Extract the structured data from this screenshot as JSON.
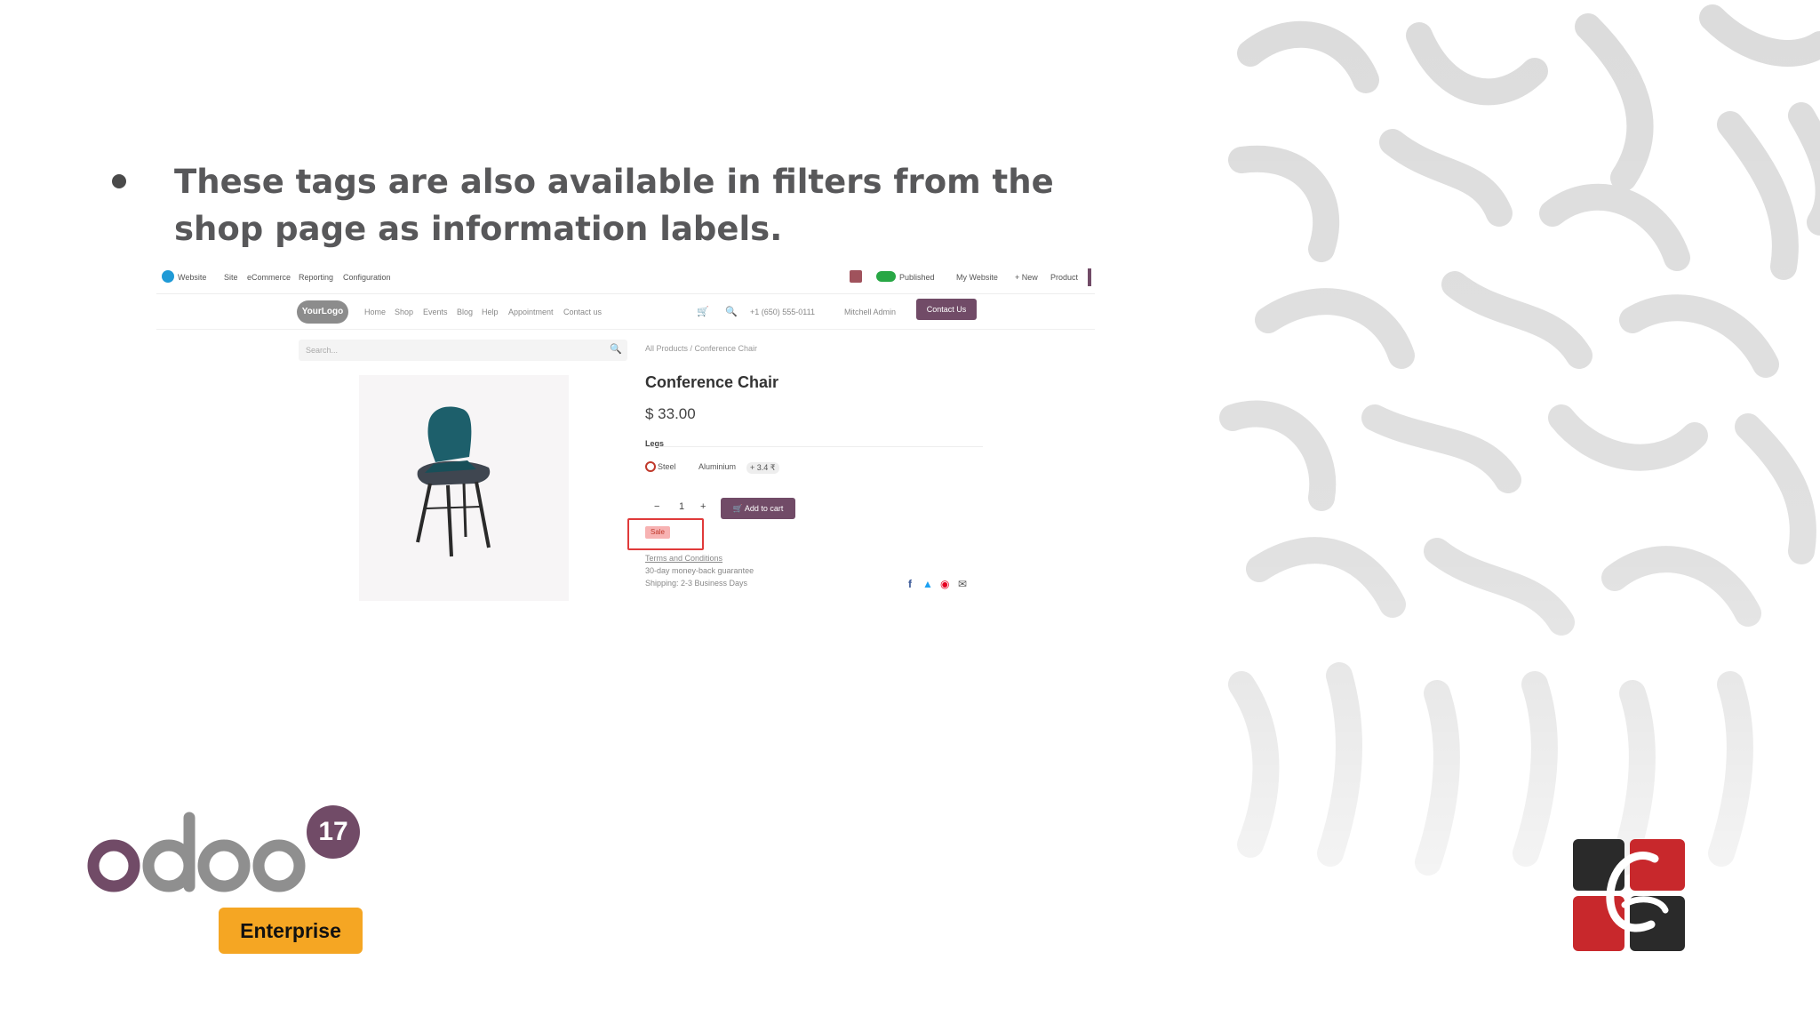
{
  "slide": {
    "bullet_text": "These tags are also available in filters from the shop page as information labels."
  },
  "screenshot": {
    "topbar": {
      "app_name": "Website",
      "menu": [
        "Site",
        "eCommerce",
        "Reporting",
        "Configuration"
      ],
      "published_label": "Published",
      "website_label": "My Website",
      "new_label": "+ New",
      "product_label": "Product"
    },
    "navbar": {
      "logo": "YourLogo",
      "links": [
        "Home",
        "Shop",
        "Events",
        "Blog",
        "Help",
        "Appointment",
        "Contact us"
      ],
      "phone": "+1 (650) 555-0111",
      "user": "Mitchell Admin",
      "contact_button": "Contact Us"
    },
    "search_placeholder": "Search...",
    "breadcrumb": "All Products / Conference Chair",
    "product": {
      "name": "Conference Chair",
      "price": "$ 33.00",
      "attribute_label": "Legs",
      "options": [
        "Steel",
        "Aluminium",
        "+ 3.4 ₹"
      ],
      "quantity": "1",
      "add_to_cart": "Add to cart",
      "tag": "Sale",
      "terms": "Terms and Conditions",
      "guarantee": "30-day money-back guarantee",
      "shipping": "Shipping: 2-3 Business Days"
    }
  },
  "branding": {
    "odoo_text": "odoo",
    "version": "17",
    "edition": "Enterprise"
  },
  "colors": {
    "heading": "#58585a",
    "odoo_purple": "#714b67",
    "odoo_gray": "#8f8f8f",
    "enterprise_badge": "#f5a623",
    "logo_red": "#c8282c",
    "logo_dark": "#2a2a2a"
  }
}
